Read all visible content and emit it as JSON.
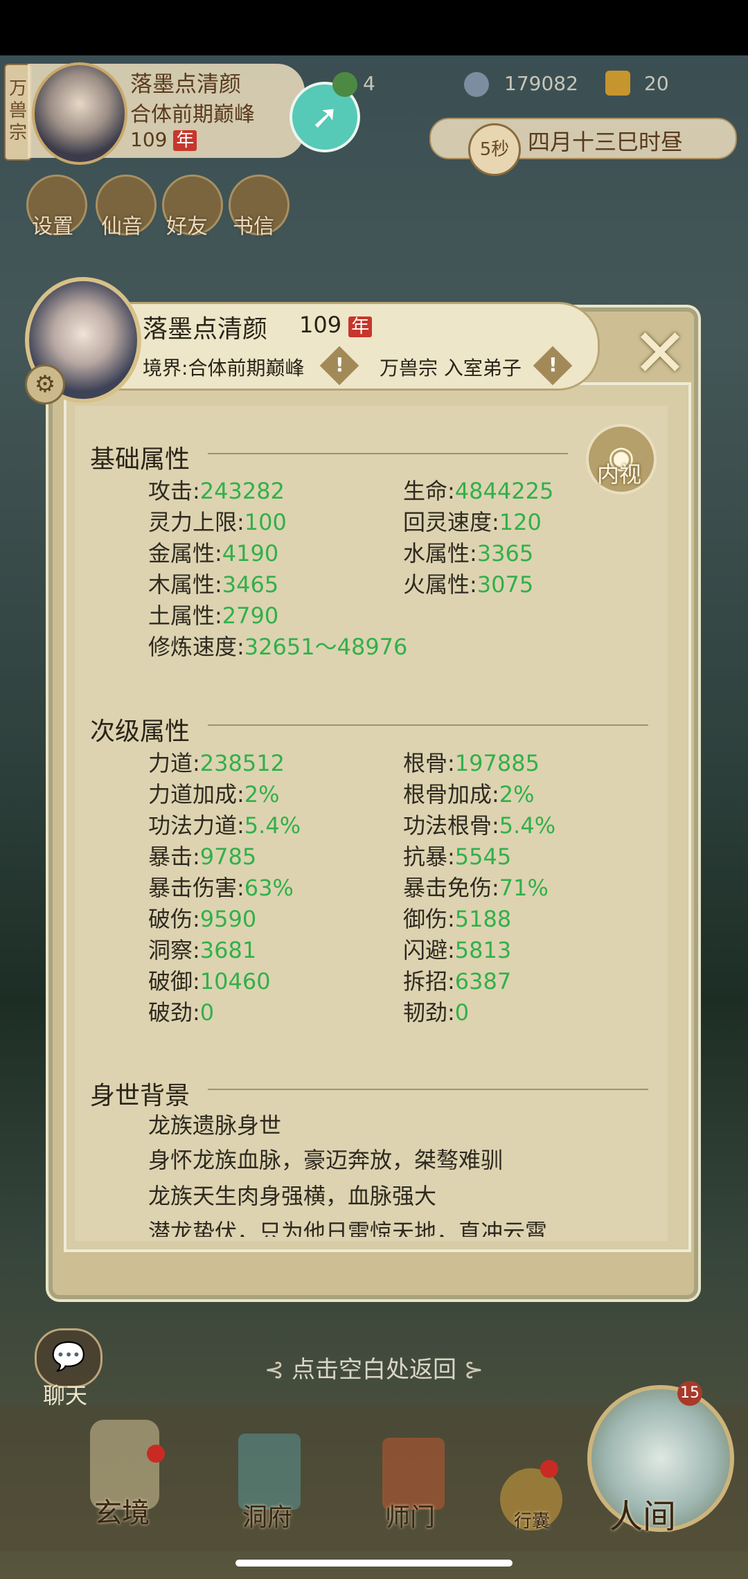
{
  "top": {
    "sect": "万兽宗",
    "player_name": "落墨点清颜",
    "realm": "合体前期巅峰",
    "age": "109",
    "age_unit": "年",
    "resources": [
      {
        "icon": "jade-icon",
        "value": "4"
      },
      {
        "icon": "coin-icon",
        "value": "179082"
      },
      {
        "icon": "gold-token-icon",
        "value": "20"
      }
    ],
    "timer": "5秒",
    "date": "四月十三巳时昼",
    "menu": [
      "设置",
      "仙音",
      "好友",
      "书信"
    ]
  },
  "panel": {
    "name": "落墨点清颜",
    "age": "109",
    "age_unit": "年",
    "realm_label": "境界:",
    "realm": "合体前期巅峰",
    "sect_rank": "万兽宗 入室弟子",
    "inner_view_label": "内视",
    "sections": {
      "basic": {
        "title": "基础属性",
        "attrs": [
          {
            "label": "攻击:",
            "value": "243282"
          },
          {
            "label": "生命:",
            "value": "4844225"
          },
          {
            "label": "灵力上限:",
            "value": "100"
          },
          {
            "label": "回灵速度:",
            "value": "120"
          },
          {
            "label": "金属性:",
            "value": "4190"
          },
          {
            "label": "水属性:",
            "value": "3365"
          },
          {
            "label": "木属性:",
            "value": "3465"
          },
          {
            "label": "火属性:",
            "value": "3075"
          },
          {
            "label": "土属性:",
            "value": "2790"
          },
          {
            "label": "修炼速度:",
            "value": "32651～48976"
          }
        ]
      },
      "secondary": {
        "title": "次级属性",
        "attrs": [
          {
            "label": "力道:",
            "value": "238512"
          },
          {
            "label": "根骨:",
            "value": "197885"
          },
          {
            "label": "力道加成:",
            "value": "2%"
          },
          {
            "label": "根骨加成:",
            "value": "2%"
          },
          {
            "label": "功法力道:",
            "value": "5.4%"
          },
          {
            "label": "功法根骨:",
            "value": "5.4%"
          },
          {
            "label": "暴击:",
            "value": "9785"
          },
          {
            "label": "抗暴:",
            "value": "5545"
          },
          {
            "label": "暴击伤害:",
            "value": "63%"
          },
          {
            "label": "暴击免伤:",
            "value": "71%"
          },
          {
            "label": "破伤:",
            "value": "9590"
          },
          {
            "label": "御伤:",
            "value": "5188"
          },
          {
            "label": "洞察:",
            "value": "3681"
          },
          {
            "label": "闪避:",
            "value": "5813"
          },
          {
            "label": "破御:",
            "value": "10460"
          },
          {
            "label": "拆招:",
            "value": "6387"
          },
          {
            "label": "破劲:",
            "value": "0"
          },
          {
            "label": "韧劲:",
            "value": "0"
          }
        ]
      },
      "background": {
        "title": "身世背景",
        "lines": [
          "龙族遗脉身世",
          "身怀龙族血脉，豪迈奔放，桀骜难驯",
          "龙族天生肉身强横，血脉强大",
          "潜龙蛰伏，只为他日雷惊天地，直冲云霄"
        ]
      }
    }
  },
  "return_hint": "点击空白处返回",
  "chat_label": "聊天",
  "bottom_nav": {
    "items": [
      "玄境",
      "洞府",
      "师门",
      "行囊",
      "人间"
    ],
    "badge_count": "15"
  },
  "colors": {
    "value_green": "#32b04a",
    "accent_teal": "#57c9b7",
    "year_red": "#c7362c"
  }
}
